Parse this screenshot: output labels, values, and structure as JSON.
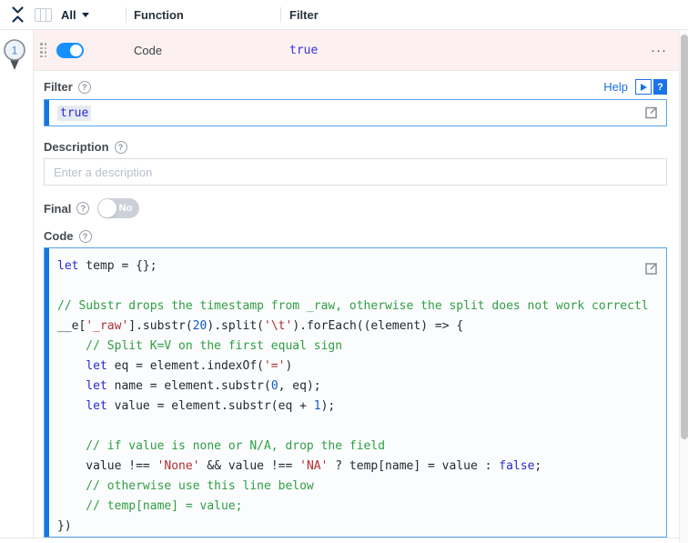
{
  "toolbar": {
    "all_label": "All",
    "function_col": "Function",
    "filter_col": "Filter"
  },
  "function_row": {
    "index": "1",
    "name": "Code",
    "filter_value": "true",
    "enabled": true,
    "more_icon": "···"
  },
  "panel": {
    "filter_label": "Filter",
    "help_label": "Help",
    "docs_help_glyph": "?",
    "qmark_glyph": "?",
    "filter_value": "true",
    "description_label": "Description",
    "description_placeholder": "Enter a description",
    "final_label": "Final",
    "final_state": "No",
    "code_label": "Code"
  },
  "colors": {
    "accent_blue": "#1677db",
    "toggle_on": "#1890ff",
    "row_highlight": "#fcf1f0",
    "focused_border": "#57a4ee",
    "help_blue": "#1a6fe8",
    "keyword": "#2a2ad4",
    "comment": "#2f9e44",
    "string": "#b12f33",
    "number": "#1158c7",
    "plain": "#24292e"
  },
  "code_editor": {
    "lines": [
      [
        [
          "k",
          "let"
        ],
        [
          "p",
          " temp = {};"
        ]
      ],
      [],
      [
        [
          "c",
          "// Substr drops the timestamp from _raw, otherwise the split does not work correctl"
        ]
      ],
      [
        [
          "p",
          "__e["
        ],
        [
          "s",
          "'_raw'"
        ],
        [
          "p",
          "].substr("
        ],
        [
          "n",
          "20"
        ],
        [
          "p",
          ").split("
        ],
        [
          "s",
          "'\\t'"
        ],
        [
          "p",
          ").forEach((element) => {"
        ]
      ],
      [
        [
          "c",
          "    // Split K=V on the first equal sign"
        ]
      ],
      [
        [
          "p",
          "    "
        ],
        [
          "k",
          "let"
        ],
        [
          "p",
          " eq = element.indexOf("
        ],
        [
          "s",
          "'='"
        ],
        [
          "p",
          ")"
        ]
      ],
      [
        [
          "p",
          "    "
        ],
        [
          "k",
          "let"
        ],
        [
          "p",
          " name = element.substr("
        ],
        [
          "n",
          "0"
        ],
        [
          "p",
          ", eq);"
        ]
      ],
      [
        [
          "p",
          "    "
        ],
        [
          "k",
          "let"
        ],
        [
          "p",
          " value = element.substr(eq + "
        ],
        [
          "n",
          "1"
        ],
        [
          "p",
          ");"
        ]
      ],
      [],
      [
        [
          "c",
          "    // if value is none or N/A, drop the field"
        ]
      ],
      [
        [
          "p",
          "    value !== "
        ],
        [
          "s",
          "'None'"
        ],
        [
          "p",
          " && value !== "
        ],
        [
          "s",
          "'NA'"
        ],
        [
          "p",
          " ? temp[name] = value : "
        ],
        [
          "k",
          "false"
        ],
        [
          "p",
          ";"
        ]
      ],
      [
        [
          "c",
          "    // otherwise use this line below"
        ]
      ],
      [
        [
          "c",
          "    // temp[name] = value;"
        ]
      ],
      [
        [
          "p",
          "})"
        ]
      ]
    ]
  }
}
